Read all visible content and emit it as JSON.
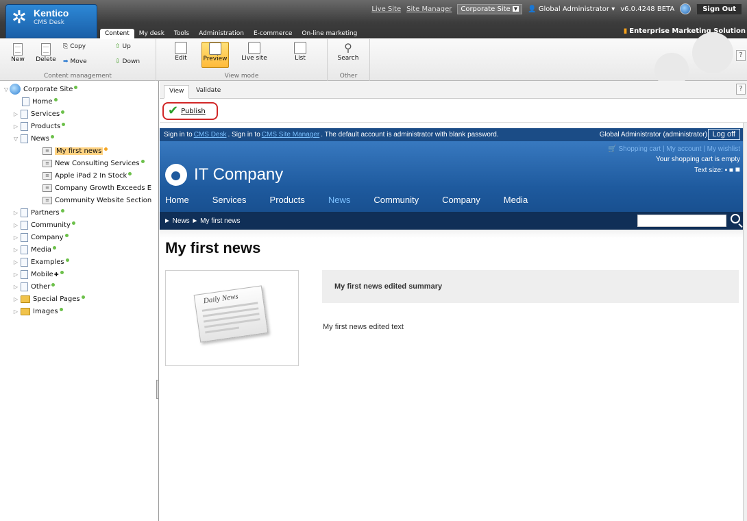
{
  "header": {
    "brand_name": "Kentico",
    "brand_sub": "CMS Desk",
    "nav": [
      "Content",
      "My desk",
      "Tools",
      "Administration",
      "E-commerce",
      "On-line marketing"
    ],
    "links": {
      "live_site": "Live Site",
      "site_manager": "Site Manager",
      "site_selector": "Corporate Site",
      "user": "Global Administrator",
      "version": "v6.0.4248 BETA",
      "sign_out": "Sign Out"
    },
    "edition": "Enterprise Marketing Solution"
  },
  "toolbar": {
    "content_mgmt": {
      "title": "Content management",
      "new": "New",
      "delete": "Delete",
      "copy": "Copy",
      "move": "Move",
      "up": "Up",
      "down": "Down"
    },
    "view_mode": {
      "title": "View mode",
      "edit": "Edit",
      "preview": "Preview",
      "live_site": "Live site",
      "list": "List"
    },
    "other": {
      "title": "Other",
      "search": "Search"
    },
    "help": "?"
  },
  "tree": {
    "root": "Corporate Site",
    "items": [
      "Home",
      "Services",
      "Products",
      "News",
      "My first news",
      "New Consulting Services",
      "Apple iPad 2 In Stock",
      "Company Growth Exceeds E",
      "Community Website Section",
      "Partners",
      "Community",
      "Company",
      "Media",
      "Examples",
      "Mobile",
      "Other",
      "Special Pages",
      "Images"
    ]
  },
  "content": {
    "tabs": [
      "View",
      "Validate"
    ],
    "help": "?",
    "publish": "Publish"
  },
  "site": {
    "signin": {
      "pre": "Sign in to",
      "cms_desk": "CMS Desk",
      "mid": ". Sign in to",
      "site_manager": "CMS Site Manager",
      "post": ". The default account is administrator with blank password.",
      "user": "Global Administrator (administrator)",
      "log_off": "Log off"
    },
    "logo": "IT Company",
    "shop": {
      "line1": "Shopping cart | My account | My wishlist",
      "line2": "Your shopping cart is empty",
      "line3": "Text size:"
    },
    "nav": [
      "Home",
      "Services",
      "Products",
      "News",
      "Community",
      "Company",
      "Media"
    ],
    "breadcrumb": "► News ► My first news",
    "news_title": "My first news",
    "paper_title": "Daily News",
    "summary": "My first news edited summary",
    "text": "My first news edited text"
  }
}
